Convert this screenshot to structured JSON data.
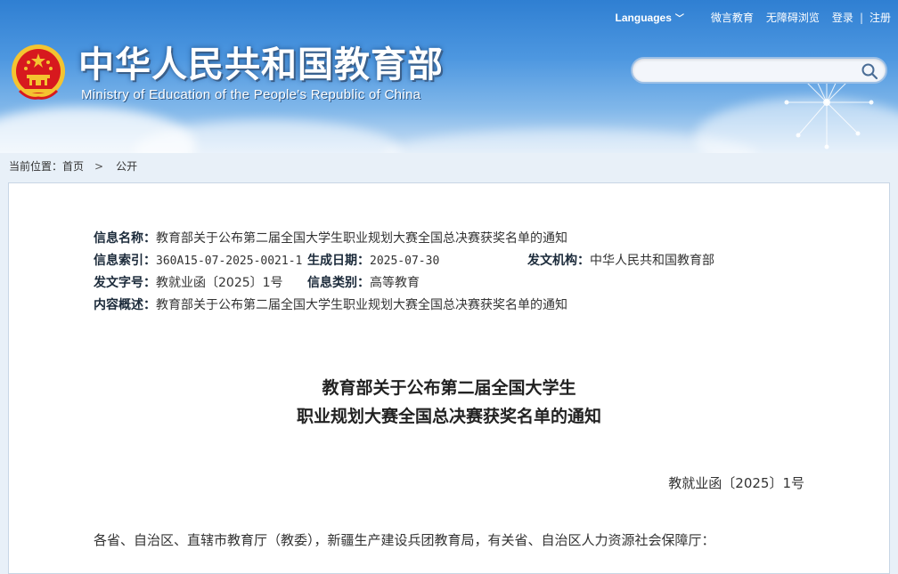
{
  "header": {
    "title": "中华人民共和国教育部",
    "subtitle": "Ministry of Education of the People's Republic of China",
    "topbar": {
      "languages": "Languages",
      "wechat": "微言教育",
      "accessibility": "无障碍浏览",
      "login": "登录",
      "separator": "|",
      "register": "注册"
    },
    "search": {
      "placeholder": "",
      "value": ""
    }
  },
  "breadcrumb": {
    "prefix": "当前位置：",
    "home": "首页",
    "current": "公开"
  },
  "meta": {
    "name_label": "信息名称：",
    "name_value": "教育部关于公布第二届全国大学生职业规划大赛全国总决赛获奖名单的通知",
    "index_label": "信息索引：",
    "index_value": "360A15-07-2025-0021-1",
    "date_label": "生成日期：",
    "date_value": "2025-07-30",
    "issuer_label": "发文机构：",
    "issuer_value": "中华人民共和国教育部",
    "docno_label": "发文字号：",
    "docno_value": "教就业函〔2025〕1号",
    "category_label": "信息类别：",
    "category_value": "高等教育",
    "summary_label": "内容概述：",
    "summary_value": "教育部关于公布第二届全国大学生职业规划大赛全国总决赛获奖名单的通知"
  },
  "document": {
    "title_line1": "教育部关于公布第二届全国大学生",
    "title_line2": "职业规划大赛全国总决赛获奖名单的通知",
    "number": "教就业函〔2025〕1号",
    "salutation": "各省、自治区、直辖市教育厅（教委），新疆生产建设兵团教育局，有关省、自治区人力资源社会保障厅："
  },
  "colors": {
    "header_top": "#2f7fd2",
    "header_bottom": "#cfe2f5",
    "emblem_red": "#d7191e",
    "emblem_gold": "#f4c430",
    "page_bg": "#e8f0f8"
  },
  "icons": {
    "emblem": "national-emblem-icon",
    "search": "search-icon",
    "languages_chevron": "chevron-down-icon",
    "breadcrumb_chevron": "chevron-right-icon"
  }
}
